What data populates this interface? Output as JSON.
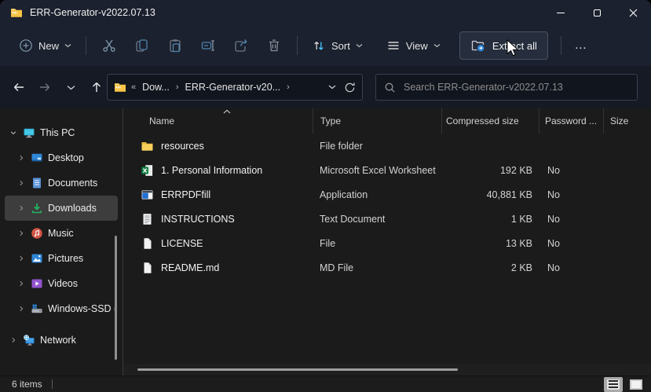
{
  "window": {
    "title": "ERR-Generator-v2022.07.13"
  },
  "colors": {
    "titlebar_bg": "#1b212e",
    "address_bg": "#151a25",
    "content_bg": "#1b1b1b",
    "accent_blue": "#4cc2ff",
    "steel_blue": "#4f82ab",
    "folder_yellow": "#f6c445",
    "excel_green": "#107c41",
    "selection_gray": "#3d3d3d"
  },
  "toolbar": {
    "new_label": "New",
    "sort_label": "Sort",
    "view_label": "View",
    "extract_label": "Extract all",
    "more_label": "…",
    "icons": [
      "new-plus-icon",
      "cut-icon",
      "copy-icon",
      "paste-icon",
      "rename-icon",
      "share-icon",
      "delete-icon",
      "sort-icon",
      "view-icon",
      "extract-icon",
      "see-more-icon"
    ]
  },
  "address": {
    "overflow": "«",
    "separator": "›",
    "crumbs": [
      "Dow...",
      "ERR-Generator-v20..."
    ],
    "search_placeholder": "Search ERR-Generator-v2022.07.13",
    "icons": [
      "back-icon",
      "forward-icon",
      "recent-locations-icon",
      "up-icon",
      "zip-folder-icon",
      "address-dropdown-icon",
      "refresh-icon",
      "search-icon"
    ]
  },
  "sidebar": {
    "items": [
      {
        "label": "This PC",
        "icon": "this-pc-icon"
      },
      {
        "label": "Desktop",
        "icon": "desktop-icon"
      },
      {
        "label": "Documents",
        "icon": "documents-icon"
      },
      {
        "label": "Downloads",
        "icon": "downloads-icon",
        "selected": true
      },
      {
        "label": "Music",
        "icon": "music-icon"
      },
      {
        "label": "Pictures",
        "icon": "pictures-icon"
      },
      {
        "label": "Videos",
        "icon": "videos-icon"
      },
      {
        "label": "Windows-SSD (",
        "icon": "drive-icon"
      },
      {
        "label": "Network",
        "icon": "network-icon"
      }
    ]
  },
  "filelist": {
    "columns": [
      "Name",
      "Type",
      "Compressed size",
      "Password ...",
      "Size"
    ],
    "rows": [
      {
        "name": "resources",
        "type": "File folder",
        "compressed": "",
        "password": "",
        "size": "",
        "icon": "folder-icon"
      },
      {
        "name": "1. Personal Information",
        "type": "Microsoft Excel Worksheet",
        "compressed": "192 KB",
        "password": "No",
        "size": "",
        "icon": "excel-icon"
      },
      {
        "name": "ERRPDFfill",
        "type": "Application",
        "compressed": "40,881 KB",
        "password": "No",
        "size": "",
        "icon": "application-icon"
      },
      {
        "name": "INSTRUCTIONS",
        "type": "Text Document",
        "compressed": "1 KB",
        "password": "No",
        "size": "",
        "icon": "text-document-icon"
      },
      {
        "name": "LICENSE",
        "type": "File",
        "compressed": "13 KB",
        "password": "No",
        "size": "",
        "icon": "file-icon"
      },
      {
        "name": "README.md",
        "type": "MD File",
        "compressed": "2 KB",
        "password": "No",
        "size": "",
        "icon": "file-icon"
      }
    ]
  },
  "statusbar": {
    "count": "6 items"
  }
}
